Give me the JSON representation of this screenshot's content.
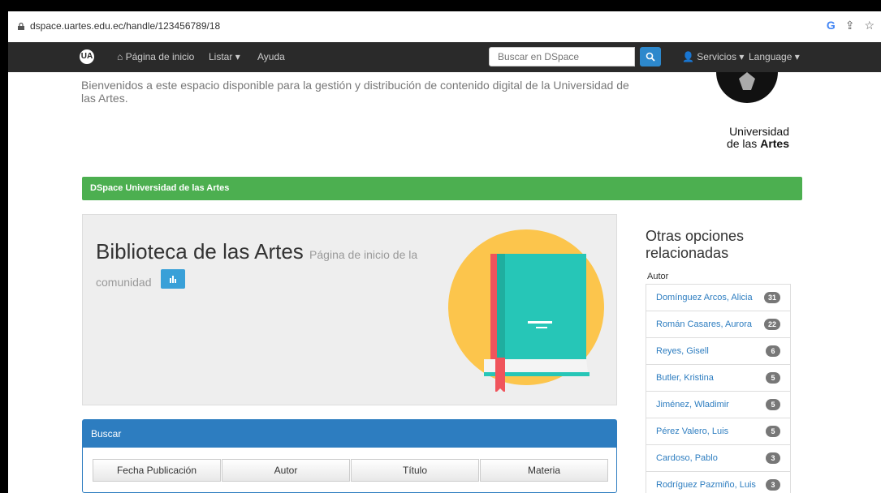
{
  "browser": {
    "url": "dspace.uartes.edu.ec/handle/123456789/18"
  },
  "navbar": {
    "logo": "UA",
    "home": "Página de inicio",
    "listar": "Listar",
    "ayuda": "Ayuda",
    "search_placeholder": "Buscar en DSpace",
    "servicios": "Servicios",
    "language": "Language"
  },
  "header": {
    "welcome": "Bienvenidos a este espacio disponible para la gestión y distribución de contenido digital de la Universidad de las Artes.",
    "logo_line1": "Universidad",
    "logo_line2_prefix": "de las ",
    "logo_line2_bold": "Artes"
  },
  "breadcrumb": "DSpace Universidad de las Artes",
  "community": {
    "title": "Biblioteca de las Artes",
    "subtitle": "Página de inicio de la comunidad"
  },
  "buscar": {
    "header": "Buscar",
    "tabs": [
      "Fecha Publicación",
      "Autor",
      "Título",
      "Materia"
    ]
  },
  "sidebar": {
    "title": "Otras opciones relacionadas",
    "autor_label": "Autor",
    "authors": [
      {
        "name": "Domínguez Arcos, Alicia",
        "count": "31"
      },
      {
        "name": "Román Casares, Aurora",
        "count": "22"
      },
      {
        "name": "Reyes, Gisell",
        "count": "6"
      },
      {
        "name": "Butler, Kristina",
        "count": "5"
      },
      {
        "name": "Jiménez, Wladimir",
        "count": "5"
      },
      {
        "name": "Pérez Valero, Luis",
        "count": "5"
      },
      {
        "name": "Cardoso, Pablo",
        "count": "3"
      },
      {
        "name": "Rodríguez Pazmiño, Luis",
        "count": "3"
      }
    ]
  },
  "colors": {
    "navbar": "#2a2a2a",
    "green": "#4caf50",
    "blue": "#2d7dc0",
    "book_cover": "#26c6b7",
    "book_spine": "#f0545c",
    "circle": "#fcc54c"
  }
}
